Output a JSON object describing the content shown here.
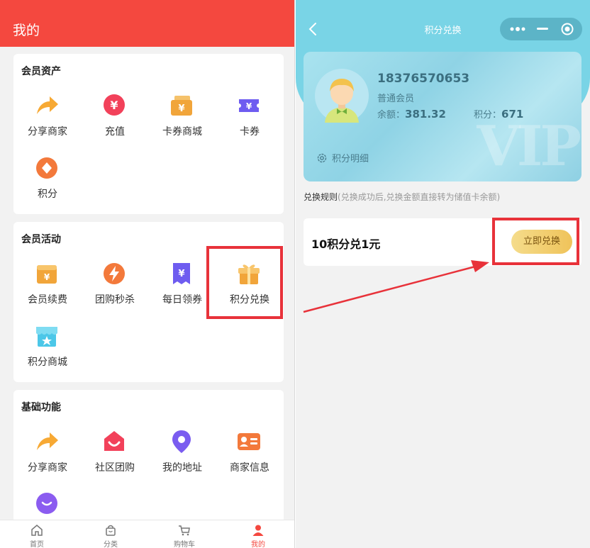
{
  "left": {
    "title": "我的",
    "sections": [
      {
        "title": "会员资产",
        "items": [
          {
            "label": "分享商家",
            "icon": "share-arrow-icon"
          },
          {
            "label": "充值",
            "icon": "yen-coin-icon"
          },
          {
            "label": "卡券商城",
            "icon": "card-mall-icon"
          },
          {
            "label": "卡券",
            "icon": "coupon-ticket-icon"
          },
          {
            "label": "积分",
            "icon": "points-coin-icon"
          }
        ]
      },
      {
        "title": "会员活动",
        "items": [
          {
            "label": "会员续费",
            "icon": "renewal-wallet-icon"
          },
          {
            "label": "团购秒杀",
            "icon": "lightning-icon"
          },
          {
            "label": "每日领券",
            "icon": "daily-coupon-icon"
          },
          {
            "label": "积分兑换",
            "icon": "gift-box-icon"
          },
          {
            "label": "积分商城",
            "icon": "store-icon"
          }
        ]
      },
      {
        "title": "基础功能",
        "items": [
          {
            "label": "分享商家",
            "icon": "share-arrow-icon"
          },
          {
            "label": "社区团购",
            "icon": "community-bag-icon"
          },
          {
            "label": "我的地址",
            "icon": "location-pin-icon"
          },
          {
            "label": "商家信息",
            "icon": "id-card-icon"
          },
          {
            "label": "",
            "icon": "chat-bubble-icon"
          }
        ]
      }
    ],
    "nav": [
      {
        "label": "首页",
        "icon": "home-icon"
      },
      {
        "label": "分类",
        "icon": "bag-icon"
      },
      {
        "label": "购物车",
        "icon": "cart-icon"
      },
      {
        "label": "我的",
        "icon": "user-icon"
      }
    ]
  },
  "right": {
    "title": "积分兑换",
    "card": {
      "phone": "18376570653",
      "level": "普通会员",
      "balance_label": "余额：",
      "balance_value": "381.32",
      "points_label": "积分：",
      "points_value": "671",
      "detail_label": "积分明细",
      "vip_watermark": "VIP"
    },
    "rule_title": "兑换规则",
    "rule_note": "(兑换成功后,兑换金额直接转为储值卡余额)",
    "exchange_text": "10积分兑1元",
    "exchange_button": "立即兑换"
  },
  "colors": {
    "header_red": "#f4483f",
    "highlight_red": "#e8323a",
    "cyan": "#79d4e6",
    "gold": "#efc35a"
  }
}
